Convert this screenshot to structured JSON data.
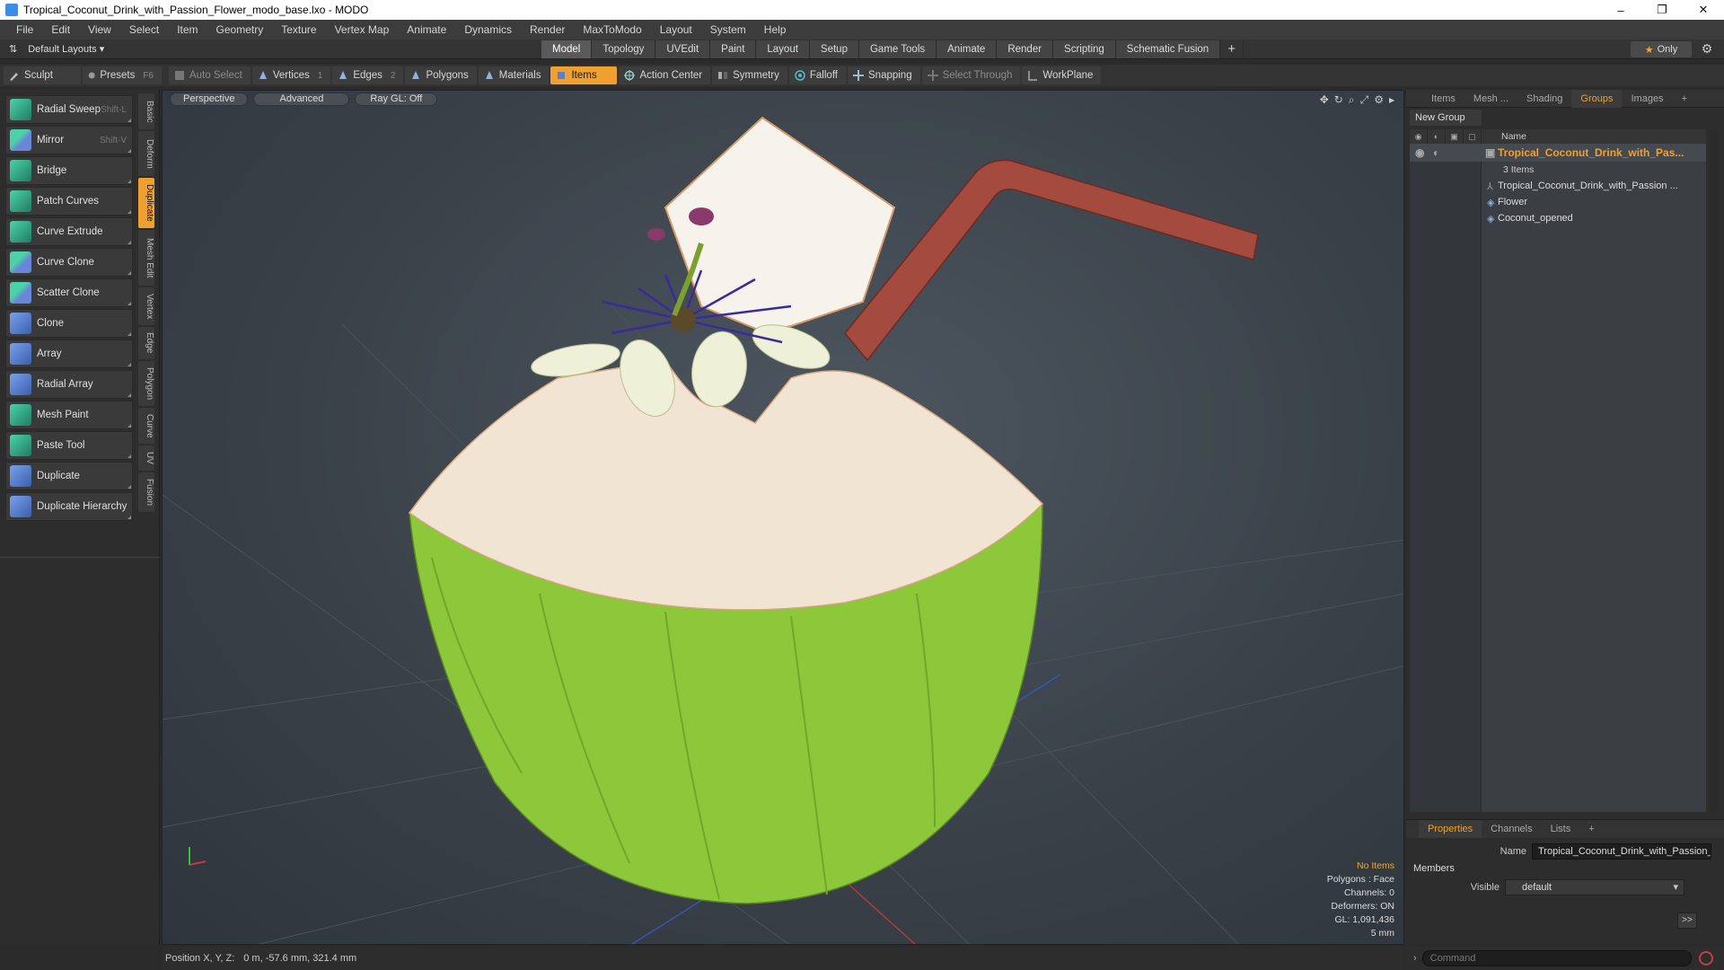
{
  "window": {
    "title": "Tropical_Coconut_Drink_with_Passion_Flower_modo_base.lxo - MODO",
    "minimize": "–",
    "restore": "❐",
    "close": "✕"
  },
  "menubar": [
    "File",
    "Edit",
    "View",
    "Select",
    "Item",
    "Geometry",
    "Texture",
    "Vertex Map",
    "Animate",
    "Dynamics",
    "Render",
    "MaxToModo",
    "Layout",
    "System",
    "Help"
  ],
  "layoutbar": {
    "layout_label": "Default Layouts ▾",
    "tabs": [
      "Model",
      "Topology",
      "UVEdit",
      "Paint",
      "Layout",
      "Setup",
      "Game Tools",
      "Animate",
      "Render",
      "Scripting",
      "Schematic Fusion"
    ],
    "active_tab": "Model",
    "add_tab": "+",
    "only_label": "Only",
    "only_star": "★"
  },
  "toolbar": {
    "sculpt": "Sculpt",
    "presets": "Presets",
    "presets_key": "F6",
    "auto_select": "Auto Select",
    "vertices": "Vertices",
    "vertices_num": "1",
    "edges": "Edges",
    "edges_num": "2",
    "polygons": "Polygons",
    "materials": "Materials",
    "items": "Items",
    "action_center": "Action Center",
    "symmetry": "Symmetry",
    "falloff": "Falloff",
    "snapping": "Snapping",
    "select_through": "Select Through",
    "workplane": "WorkPlane"
  },
  "tools": [
    {
      "label": "Radial Sweep",
      "key": "Shift-L",
      "style": "teal"
    },
    {
      "label": "Mirror",
      "key": "Shift-V",
      "style": "mix"
    },
    {
      "label": "Bridge",
      "key": "",
      "style": "teal"
    },
    {
      "label": "Patch Curves",
      "key": "",
      "style": "teal"
    },
    {
      "label": "Curve Extrude",
      "key": "",
      "style": "teal"
    },
    {
      "label": "Curve Clone",
      "key": "",
      "style": "mix"
    },
    {
      "label": "Scatter Clone",
      "key": "",
      "style": "mix"
    },
    {
      "label": "Clone",
      "key": "",
      "style": "blue"
    },
    {
      "label": "Array",
      "key": "",
      "style": "blue"
    },
    {
      "label": "Radial Array",
      "key": "",
      "style": "blue"
    },
    {
      "label": "Mesh Paint",
      "key": "",
      "style": "teal"
    },
    {
      "label": "Paste Tool",
      "key": "",
      "style": "teal"
    },
    {
      "label": "Duplicate",
      "key": "",
      "style": "blue"
    },
    {
      "label": "Duplicate Hierarchy",
      "key": "",
      "style": "blue"
    }
  ],
  "side_tabs": [
    "Basic",
    "Deform",
    "Duplicate",
    "Mesh Edit",
    "Vertex",
    "Edge",
    "Polygon",
    "Curve",
    "UV",
    "Fusion"
  ],
  "active_side_tab": "Duplicate",
  "viewport": {
    "view_mode": "Perspective",
    "shading": "Advanced",
    "raygl": "Ray GL: Off",
    "info": {
      "selection": "No Items",
      "polygons": "Polygons : Face",
      "channels": "Channels: 0",
      "deformers": "Deformers: ON",
      "gl": "GL: 1,091,436",
      "scale": "5 mm"
    }
  },
  "right_panel": {
    "tabs": [
      "Items",
      "Mesh ...",
      "Shading",
      "Groups",
      "Images",
      "+"
    ],
    "active_tab": "Groups",
    "new_group": "New Group",
    "name_header": "Name",
    "group_name": "Tropical_Coconut_Drink_with_Pas...",
    "group_count": "3 Items",
    "items": [
      "Tropical_Coconut_Drink_with_Passion ...",
      "Flower",
      "Coconut_opened"
    ]
  },
  "properties": {
    "tabs": [
      "Properties",
      "Channels",
      "Lists",
      "+"
    ],
    "active_tab": "Properties",
    "name_label": "Name",
    "name_value": "Tropical_Coconut_Drink_with_Passion_F",
    "members_label": "Members",
    "visible_label": "Visible",
    "visible_value": "default",
    "arrow_btn": ">>"
  },
  "status": {
    "position_label": "Position X, Y, Z:",
    "position_value": "0 m, -57.6 mm, 321.4 mm"
  },
  "command": {
    "placeholder": "Command"
  },
  "colors": {
    "accent": "#f0a030",
    "viewport_bg": "#3a4149",
    "coconut_green": "#8cc83a",
    "straw": "#a54a3e"
  }
}
